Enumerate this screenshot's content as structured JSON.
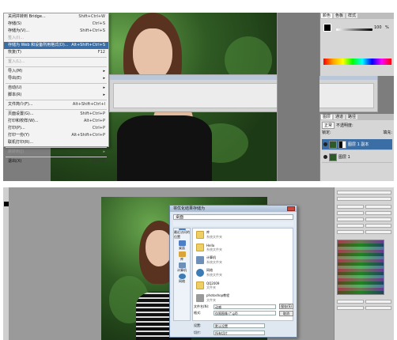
{
  "top_screenshot": {
    "file_menu": {
      "items": [
        {
          "label": "关闭并转到 Bridge...",
          "shortcut": "Shift+Ctrl+W",
          "state": "normal"
        },
        {
          "label": "存储(S)",
          "shortcut": "Ctrl+S",
          "state": "normal"
        },
        {
          "label": "存储为(V)...",
          "shortcut": "Shift+Ctrl+S",
          "state": "normal"
        },
        {
          "label": "签入(I)...",
          "shortcut": "",
          "state": "disabled"
        },
        {
          "label": "存储为 Web 和设备所用格式(D)...",
          "shortcut": "Alt+Shift+Ctrl+S",
          "state": "selected"
        },
        {
          "label": "恢复(T)",
          "shortcut": "F12",
          "state": "normal"
        },
        {
          "sep": true
        },
        {
          "label": "置入(L)...",
          "shortcut": "",
          "state": "disabled"
        },
        {
          "sep": true
        },
        {
          "label": "导入(M)",
          "shortcut": "",
          "state": "submenu"
        },
        {
          "label": "导出(E)",
          "shortcut": "",
          "state": "submenu"
        },
        {
          "sep": true
        },
        {
          "label": "自动(U)",
          "shortcut": "",
          "state": "submenu"
        },
        {
          "label": "脚本(R)",
          "shortcut": "",
          "state": "submenu"
        },
        {
          "sep": true
        },
        {
          "label": "文件简介(F)...",
          "shortcut": "Alt+Shift+Ctrl+I",
          "state": "normal"
        },
        {
          "sep": true
        },
        {
          "label": "页面设置(G)...",
          "shortcut": "Shift+Ctrl+P",
          "state": "normal"
        },
        {
          "label": "打印和校样(W)...",
          "shortcut": "Alt+Ctrl+P",
          "state": "normal"
        },
        {
          "label": "打印(P)...",
          "shortcut": "Ctrl+P",
          "state": "normal"
        },
        {
          "label": "打印一份(Y)",
          "shortcut": "Alt+Shift+Ctrl+P",
          "state": "normal"
        },
        {
          "label": "联机打印(R)...",
          "shortcut": "",
          "state": "normal"
        },
        {
          "sep": true
        },
        {
          "label": "跳转到(J)",
          "shortcut": "",
          "state": "submenu-disabled"
        },
        {
          "sep": true
        },
        {
          "label": "退出(X)",
          "shortcut": "Ctrl+Q",
          "state": "normal"
        }
      ]
    },
    "color_panel": {
      "tabs": [
        "颜色",
        "色板",
        "样式"
      ],
      "value": "100",
      "unit": "%"
    },
    "layers_panel": {
      "tabs": [
        "图层",
        "通道",
        "路径"
      ],
      "blend_mode": "正常",
      "opacity_label": "不透明度:",
      "fill_label": "填充:",
      "lock_label": "锁定:",
      "layers": [
        {
          "name": "图层 1 副本",
          "selected": true
        },
        {
          "name": "图层 1",
          "selected": false
        }
      ]
    }
  },
  "bottom_screenshot": {
    "dialog": {
      "title": "将优化结果存储为",
      "address": "桌面",
      "nav_items": [
        "最近访问的位置",
        "桌面",
        "库",
        "计算机",
        "网络"
      ],
      "files": [
        {
          "name": "库",
          "sub": "系统文件夹",
          "icon": "folder"
        },
        {
          "name": "Hello",
          "sub": "系统文件夹",
          "icon": "folder"
        },
        {
          "name": "计算机",
          "sub": "系统文件夹",
          "icon": "pc"
        },
        {
          "name": "网络",
          "sub": "系统文件夹",
          "icon": "network"
        },
        {
          "name": "QQ2009",
          "sub": "文件夹",
          "icon": "folder"
        },
        {
          "name": "photoshop教程",
          "sub": "文件夹",
          "icon": "cabinet"
        }
      ],
      "filename_label": "文件名(N):",
      "filename_value": "动感",
      "format_label": "格式:",
      "format_value": "仅限图像 (*.gif)",
      "settings_label": "设置:",
      "settings_value": "默认设置",
      "slices_label": "切片:",
      "slices_value": "所有切片",
      "save_button": "保存(S)",
      "cancel_button": "取消"
    }
  }
}
